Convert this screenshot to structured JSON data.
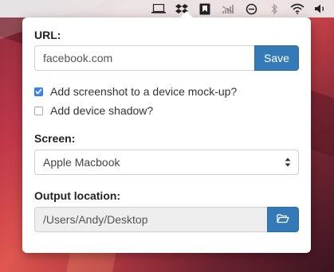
{
  "menubar": {
    "icons": [
      "laptop-icon",
      "dropbox-icon",
      "bookmark-icon",
      "signal-icon",
      "sync-icon",
      "bluetooth-icon",
      "wifi-icon",
      "volume-icon"
    ]
  },
  "form": {
    "url_label": "URL:",
    "url_value": "facebook.com",
    "save_label": "Save",
    "mockup_label": "Add screenshot to a device mock-up?",
    "mockup_checked": true,
    "shadow_label": "Add device shadow?",
    "shadow_checked": false,
    "screen_label": "Screen:",
    "screen_value": "Apple Macbook",
    "output_label": "Output location:",
    "output_value": "/Users/Andy/Desktop"
  },
  "colors": {
    "accent": "#337ab7",
    "checkbox_checked": "#3f86f7"
  }
}
